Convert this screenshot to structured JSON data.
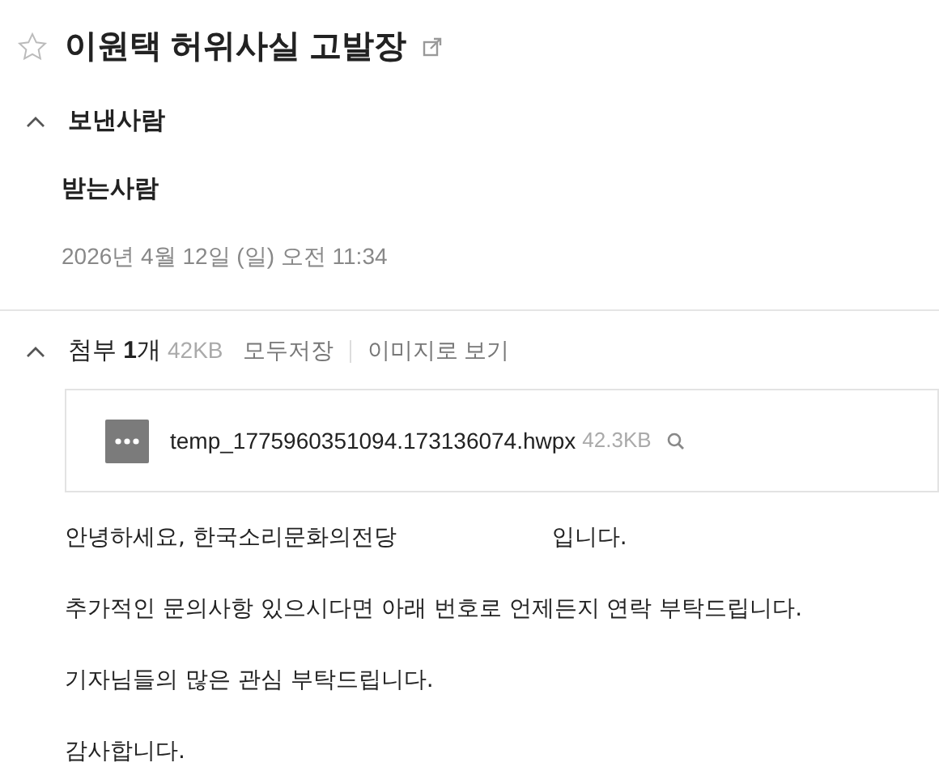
{
  "mail": {
    "title": "이원택 허위사실 고발장",
    "starred": false
  },
  "sender": {
    "label": "보낸사람",
    "expanded": true
  },
  "recipient": {
    "label": "받는사람"
  },
  "date": "2026년 4월 12일 (일) 오전 11:34",
  "attachments": {
    "expanded": true,
    "summary": "첨부 **1**개",
    "size": "42KB",
    "actions": [
      "모두저장",
      "이미지로 보기"
    ],
    "files": [
      {
        "name": "temp_1775960351094.173136074.hwpx",
        "size": "42.3KB"
      }
    ]
  },
  "body": [
    {
      "parts": [
        "안녕하세요, 한국소리문화의전당",
        "입니다."
      ]
    },
    {
      "parts": [
        "추가적인 문의사항 있으시다면 아래 번호로 언제든지 연락 부탁드립니다."
      ]
    },
    {
      "parts": [
        "기자님들의 많은 관심 부탁드립니다."
      ]
    },
    {
      "parts": [
        "감사합니다."
      ]
    }
  ]
}
